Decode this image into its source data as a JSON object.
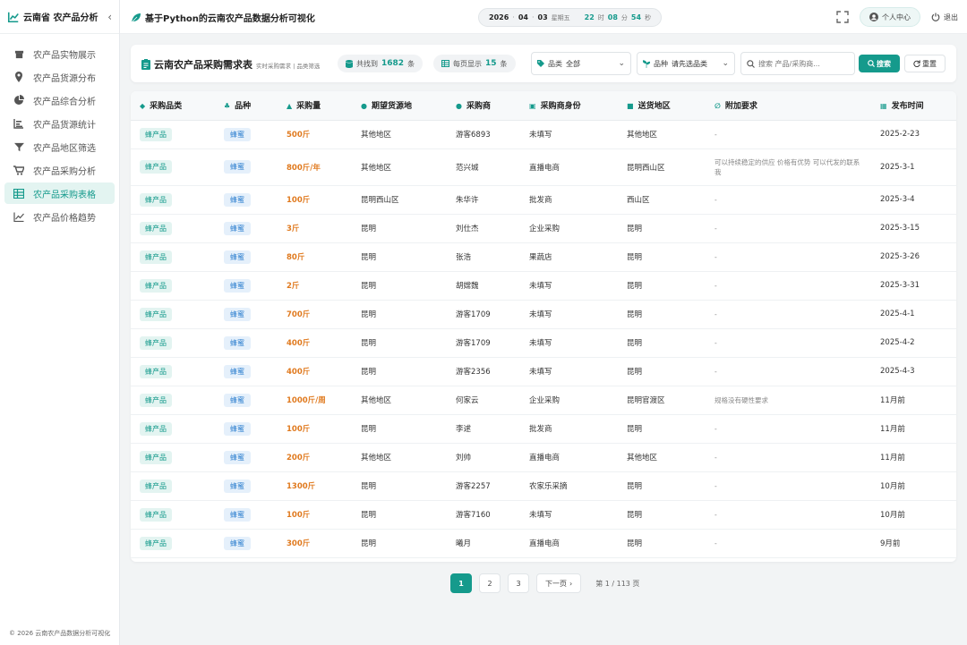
{
  "brand": {
    "title": "云南省 农产品分析",
    "collapse_icon": "chevron-left-icon"
  },
  "sidebar": {
    "items": [
      {
        "label": "农产品实物展示",
        "icon": "box-icon"
      },
      {
        "label": "农产品货源分布",
        "icon": "map-pin-icon"
      },
      {
        "label": "农产品综合分析",
        "icon": "pie-chart-icon"
      },
      {
        "label": "农产品货源统计",
        "icon": "bar-chart-icon"
      },
      {
        "label": "农产品地区筛选",
        "icon": "filter-icon"
      },
      {
        "label": "农产品采购分析",
        "icon": "cart-icon"
      },
      {
        "label": "农产品采购表格",
        "icon": "table-icon",
        "active": true
      },
      {
        "label": "农产品价格趋势",
        "icon": "line-chart-icon"
      }
    ],
    "footer": "© 2026 云南农产品数据分析可视化"
  },
  "topbar": {
    "app_title": "基于Python的云南农产品数据分析可视化",
    "clock": {
      "year": "2026",
      "month": "04",
      "day": "03",
      "weekday": "星期五",
      "hour": "22",
      "hour_unit": "时",
      "minute": "08",
      "minute_unit": "分",
      "second": "54",
      "second_unit": "秒"
    },
    "user_label": "个人中心",
    "logout_label": "退出"
  },
  "filter": {
    "title": "云南农产品采购需求表",
    "subtitle": "实时采购需求 | 品类筛选",
    "found_label": "共找到",
    "found_count": "1682",
    "found_unit": "条",
    "per_page_label": "每页显示",
    "per_page_count": "15",
    "per_page_unit": "条",
    "category_label": "品类",
    "category_value": "全部",
    "variety_label": "品种",
    "variety_value": "请先选品类",
    "search_placeholder": "搜索 产品/采购商...",
    "search_button": "搜索",
    "reset_button": "重置"
  },
  "table": {
    "headers": [
      "采购品类",
      "品种",
      "采购量",
      "期望货源地",
      "采购商",
      "采购商身份",
      "送货地区",
      "附加要求",
      "发布时间"
    ],
    "rows": [
      [
        "蜂产品",
        "蜂蜜",
        "500斤",
        "其他地区",
        "游客6893",
        "未填写",
        "其他地区",
        "-",
        "2025-2-23"
      ],
      [
        "蜂产品",
        "蜂蜜",
        "800斤/年",
        "其他地区",
        "范兴城",
        "直播电商",
        "昆明西山区",
        "可以持续稳定的供应 价格有优势 可以代发的联系我",
        "2025-3-1"
      ],
      [
        "蜂产品",
        "蜂蜜",
        "100斤",
        "昆明西山区",
        "朱华许",
        "批发商",
        "西山区",
        "-",
        "2025-3-4"
      ],
      [
        "蜂产品",
        "蜂蜜",
        "3斤",
        "昆明",
        "刘仕杰",
        "企业采购",
        "昆明",
        "-",
        "2025-3-15"
      ],
      [
        "蜂产品",
        "蜂蜜",
        "80斤",
        "昆明",
        "张浩",
        "果蔬店",
        "昆明",
        "-",
        "2025-3-26"
      ],
      [
        "蜂产品",
        "蜂蜜",
        "2斤",
        "昆明",
        "胡嫦魏",
        "未填写",
        "昆明",
        "-",
        "2025-3-31"
      ],
      [
        "蜂产品",
        "蜂蜜",
        "700斤",
        "昆明",
        "游客1709",
        "未填写",
        "昆明",
        "-",
        "2025-4-1"
      ],
      [
        "蜂产品",
        "蜂蜜",
        "400斤",
        "昆明",
        "游客1709",
        "未填写",
        "昆明",
        "-",
        "2025-4-2"
      ],
      [
        "蜂产品",
        "蜂蜜",
        "400斤",
        "昆明",
        "游客2356",
        "未填写",
        "昆明",
        "-",
        "2025-4-3"
      ],
      [
        "蜂产品",
        "蜂蜜",
        "1000斤/周",
        "其他地区",
        "何家云",
        "企业采购",
        "昆明官渡区",
        "规格没有硬性要求",
        "11月前"
      ],
      [
        "蜂产品",
        "蜂蜜",
        "100斤",
        "昆明",
        "李逑",
        "批发商",
        "昆明",
        "-",
        "11月前"
      ],
      [
        "蜂产品",
        "蜂蜜",
        "200斤",
        "其他地区",
        "刘帅",
        "直播电商",
        "其他地区",
        "-",
        "11月前"
      ],
      [
        "蜂产品",
        "蜂蜜",
        "1300斤",
        "昆明",
        "游客2257",
        "农家乐采摘",
        "昆明",
        "-",
        "10月前"
      ],
      [
        "蜂产品",
        "蜂蜜",
        "100斤",
        "昆明",
        "游客7160",
        "未填写",
        "昆明",
        "-",
        "10月前"
      ],
      [
        "蜂产品",
        "蜂蜜",
        "300斤",
        "昆明",
        "曦月",
        "直播电商",
        "昆明",
        "-",
        "9月前"
      ]
    ]
  },
  "pagination": {
    "pages": [
      "1",
      "2",
      "3"
    ],
    "next_label": "下一页",
    "info": "第 1 / 113 页"
  },
  "colors": {
    "accent": "#159a8c",
    "quantity": "#e07a1f",
    "variety_tag": "#2d7fcf"
  }
}
